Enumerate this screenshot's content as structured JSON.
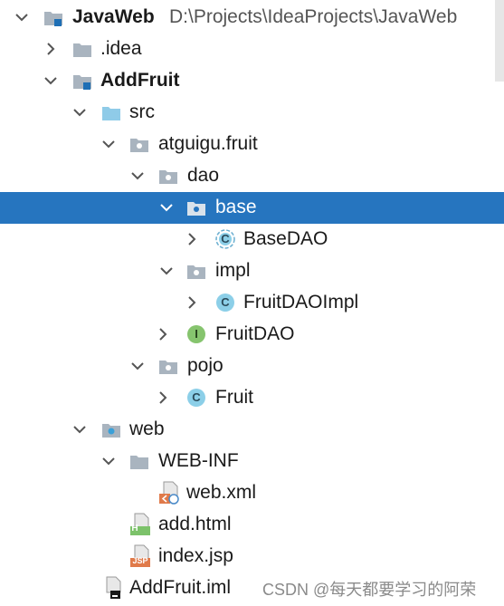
{
  "project_tree": {
    "root": {
      "name": "JavaWeb",
      "path": "D:\\Projects\\IdeaProjects\\JavaWeb"
    },
    "items": [
      {
        "label": ".idea"
      },
      {
        "label": "AddFruit"
      },
      {
        "label": "src"
      },
      {
        "label": "atguigu.fruit"
      },
      {
        "label": "dao"
      },
      {
        "label": "base"
      },
      {
        "label": "BaseDAO"
      },
      {
        "label": "impl"
      },
      {
        "label": "FruitDAOImpl"
      },
      {
        "label": "FruitDAO"
      },
      {
        "label": "pojo"
      },
      {
        "label": "Fruit"
      },
      {
        "label": "web"
      },
      {
        "label": "WEB-INF"
      },
      {
        "label": "web.xml"
      },
      {
        "label": "add.html"
      },
      {
        "label": "index.jsp"
      },
      {
        "label": "AddFruit.iml"
      }
    ],
    "icon_letters": {
      "class": "C",
      "interface": "I",
      "html": "H",
      "jsp": "JSP"
    }
  },
  "colors": {
    "selection": "#2675bf",
    "folder": "#a9b4bf",
    "source_folder": "#8fcbe8",
    "module_accent": "#1e6fb5",
    "class_icon": "#8ccfe8",
    "interface_icon": "#86c46e"
  },
  "watermark": "CSDN @每天都要学习的阿荣"
}
